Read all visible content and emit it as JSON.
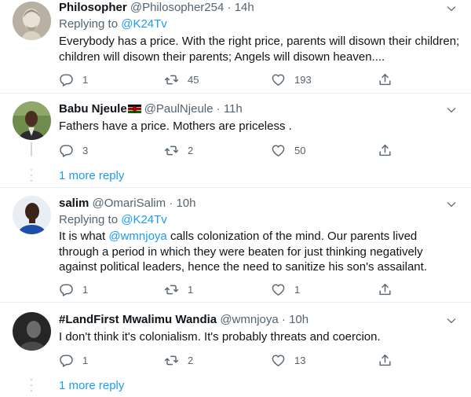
{
  "tweets": [
    {
      "name": "Philosopher",
      "handle": "@Philosopher254",
      "dot": "·",
      "time": "14h",
      "replying_prefix": "Replying to ",
      "replying_handle": "@K24Tv",
      "text": "Everybody has a price. With the right price, parents will disown their children; children will disown their parents; Angels will disown heaven....",
      "replies": "1",
      "retweets": "45",
      "likes": "193"
    },
    {
      "name": "Babu Njeule",
      "handle": "@PaulNjeule",
      "dot": "·",
      "time": "11h",
      "text": "Fathers have a price. Mothers are priceless .",
      "replies": "3",
      "retweets": "2",
      "likes": "50"
    },
    {
      "name": "salim",
      "handle": "@OmariSalim",
      "dot": "·",
      "time": "10h",
      "replying_prefix": "Replying to ",
      "replying_handle": "@K24Tv",
      "text_part1": "It is what ",
      "text_mention": "@wmnjoya",
      "text_part2": " calls colonization of the mind. Our parents lived through a period in which they were beaten for just thinking negatively against political leaders, hence the need to sanitize his son's assailant.",
      "replies": "1",
      "retweets": "1",
      "likes": "1"
    },
    {
      "name": "#LandFirst Mwalimu Wandia",
      "handle": "@wmnjoya",
      "dot": "·",
      "time": "10h",
      "text": "I don't think it's colonialism. It's probably threats and coercion.",
      "replies": "1",
      "retweets": "2",
      "likes": "13"
    }
  ],
  "more_replies_1": "1 more reply",
  "more_replies_2": "1 more reply",
  "colors": {
    "link": "#1d9bf0",
    "secondary_text": "#536471",
    "divider": "#e6ecf0"
  },
  "icons": [
    "reply-icon",
    "retweet-icon",
    "like-icon",
    "share-icon",
    "caret-down-icon",
    "kenya-flag-icon"
  ]
}
